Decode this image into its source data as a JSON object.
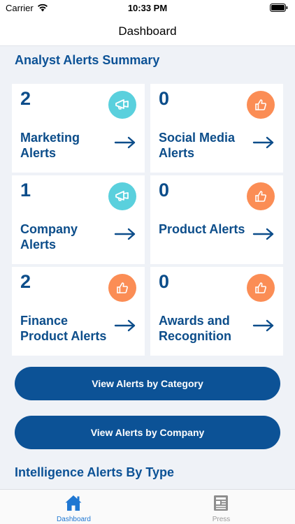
{
  "status_bar": {
    "carrier": "Carrier",
    "time": "10:33 PM"
  },
  "nav": {
    "title": "Dashboard"
  },
  "summary": {
    "title": "Analyst Alerts Summary",
    "cards": [
      {
        "count": "2",
        "label": "Marketing Alerts",
        "badge_icon": "megaphone-icon",
        "badge_color": "#5ad0dd"
      },
      {
        "count": "0",
        "label": "Social Media Alerts",
        "badge_icon": "thumbs-up-icon",
        "badge_color": "#fb8d55"
      },
      {
        "count": "1",
        "label": "Company Alerts",
        "badge_icon": "megaphone-icon",
        "badge_color": "#5ad0dd"
      },
      {
        "count": "0",
        "label": "Product Alerts",
        "badge_icon": "thumbs-up-icon",
        "badge_color": "#fb8d55"
      },
      {
        "count": "2",
        "label": "Finance Product Alerts",
        "badge_icon": "thumbs-up-icon",
        "badge_color": "#fb8d55"
      },
      {
        "count": "0",
        "label": "Awards and Recognition",
        "badge_icon": "thumbs-up-icon",
        "badge_color": "#fb8d55"
      }
    ]
  },
  "buttons": {
    "by_category": "View Alerts by Category",
    "by_company": "View Alerts by Company"
  },
  "intelligence": {
    "title": "Intelligence Alerts By Type"
  },
  "tab_bar": {
    "tabs": [
      {
        "label": "Dashboard",
        "icon": "home-icon",
        "active": true
      },
      {
        "label": "Press",
        "icon": "newspaper-icon",
        "active": false
      }
    ]
  },
  "colors": {
    "brand": "#0c5296",
    "background": "#eff2f7",
    "active_tab": "#1f77d2"
  }
}
